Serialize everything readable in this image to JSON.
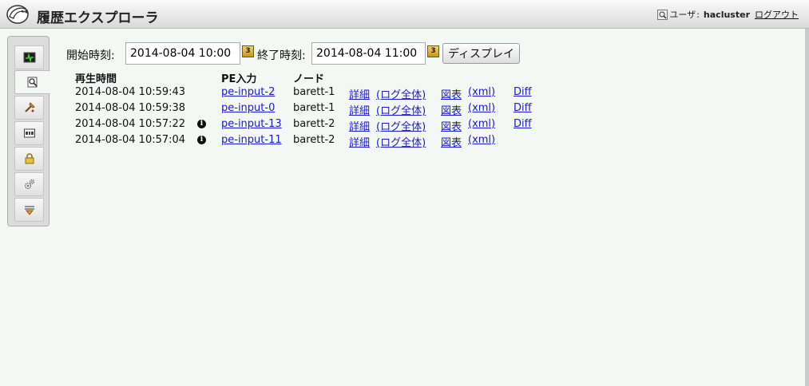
{
  "header": {
    "title": "履歴エクスプローラ",
    "user_prefix": "ユーザ",
    "user_sep": ":",
    "username": "hacluster",
    "logout": "ログアウト"
  },
  "sidebar": {
    "items": [
      {
        "name": "status-icon"
      },
      {
        "name": "history-explorer-icon",
        "active": true
      },
      {
        "name": "tools-icon"
      },
      {
        "name": "cib-editor-icon"
      },
      {
        "name": "access-control-icon"
      },
      {
        "name": "configuration-icon"
      },
      {
        "name": "wizards-icon"
      }
    ]
  },
  "toolbar": {
    "start_label": "開始時刻:",
    "start_value": "2014-08-04 10:00",
    "end_label": "終了時刻:",
    "end_value": "2014-08-04 11:00",
    "display_button": "ディスプレイ"
  },
  "table": {
    "headers": {
      "time": "再生時間",
      "pe_input": "PE入力",
      "node": "ノード"
    },
    "rows": [
      {
        "time": "2014-08-04 10:59:43",
        "info": false,
        "pe": "pe-input-2",
        "node": "barett-1",
        "details": "詳細",
        "log": "(ログ全体)",
        "graph": "図表",
        "xml": "(xml)",
        "diff": "Diff"
      },
      {
        "time": "2014-08-04 10:59:38",
        "info": false,
        "pe": "pe-input-0",
        "node": "barett-1",
        "details": "詳細",
        "log": "(ログ全体)",
        "graph": "図表",
        "xml": "(xml)",
        "diff": "Diff"
      },
      {
        "time": "2014-08-04 10:57:22",
        "info": true,
        "pe": "pe-input-13",
        "node": "barett-2",
        "details": "詳細",
        "log": "(ログ全体)",
        "graph": "図表",
        "xml": "(xml)",
        "diff": "Diff"
      },
      {
        "time": "2014-08-04 10:57:04",
        "info": true,
        "pe": "pe-input-11",
        "node": "barett-2",
        "details": "詳細",
        "log": "(ログ全体)",
        "graph": "図表",
        "xml": "(xml)",
        "diff": ""
      }
    ],
    "info_symbol": "i"
  }
}
